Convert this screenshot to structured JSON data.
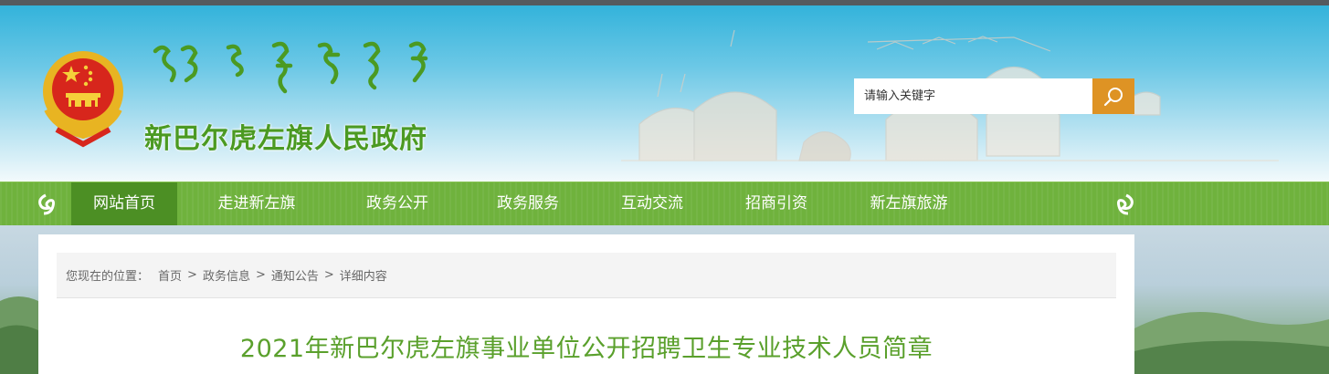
{
  "header": {
    "site_title": "新巴尔虎左旗人民政府",
    "search": {
      "placeholder": "请输入关键字"
    }
  },
  "nav": {
    "items": [
      {
        "label": "网站首页",
        "active": true
      },
      {
        "label": "走进新左旗"
      },
      {
        "label": "政务公开"
      },
      {
        "label": "政务服务"
      },
      {
        "label": "互动交流"
      },
      {
        "label": "招商引资"
      },
      {
        "label": "新左旗旅游"
      }
    ]
  },
  "breadcrumb": {
    "lead": "您现在的位置：",
    "items": [
      "首页",
      "政务信息",
      "通知公告",
      "详细内容"
    ],
    "separator": ">"
  },
  "article": {
    "title": "2021年新巴尔虎左旗事业单位公开招聘卫生专业技术人员简章"
  },
  "colors": {
    "brand_green": "#5aa02c",
    "nav_green": "#6fb23d",
    "nav_active": "#4c8f24",
    "search_button": "#de9324"
  }
}
